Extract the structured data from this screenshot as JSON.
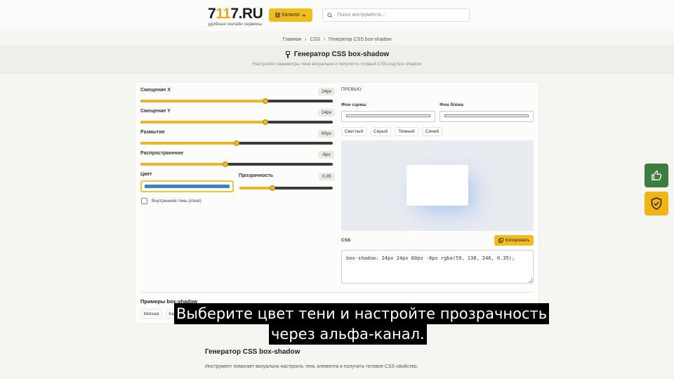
{
  "header": {
    "logo_prefix": "7",
    "logo_mid1": "1",
    "logo_mid2": "1",
    "logo_suffix": "7.RU",
    "logo_sub": "удобные онлайн сервисы",
    "catalog_label": "Каталог",
    "search_placeholder": "Поиск инструмента..."
  },
  "breadcrumb": [
    "Главная",
    "CSS",
    "Генератор CSS box-shadow"
  ],
  "page": {
    "title": "Генератор CSS box-shadow",
    "subtitle": "Настройте параметры тени визуально и получите готовый CSS-код box-shadow"
  },
  "controls": {
    "offset_x": {
      "label": "Смещение X",
      "value": "24px",
      "level": 0.65
    },
    "offset_y": {
      "label": "Смещение Y",
      "value": "24px",
      "level": 0.65
    },
    "blur": {
      "label": "Размытие",
      "value": "60px",
      "level": 0.5
    },
    "spread": {
      "label": "Распространение",
      "value": "-8px",
      "level": 0.44
    },
    "color_label": "Цвет",
    "color_value": "#3b82c4",
    "opacity": {
      "label": "Прозрачность",
      "value": "0.35",
      "level": 0.35
    },
    "inset_label": "Внутренняя тень (inset)",
    "inset_checked": false
  },
  "preview": {
    "label": "ПРЕВЬЮ",
    "scene_bg_label": "Фон сцены",
    "block_bg_label": "Фон блока",
    "bg_chips": [
      "Светлый",
      "Серый",
      "Темный",
      "Синий"
    ]
  },
  "css": {
    "label": "CSS",
    "copy_label": "Копировать",
    "code": "box-shadow: 24px 24px 60px -8px rgba(59, 130, 246, 0.35);"
  },
  "examples": {
    "title": "Примеры box-shadow",
    "chips": [
      "Мягкая",
      "Ка"
    ]
  },
  "subtitles": {
    "line1": "Выберите цвет тени и настройте прозрачность",
    "line2": "через альфа-канал."
  },
  "bottom": {
    "title": "Генератор CSS box-shadow",
    "text": "Инструмент помогает визуально настроить тень элемента и получить готовое CSS-свойство."
  },
  "side_buttons": [
    "thumbs-up-icon",
    "shield-check-icon"
  ],
  "colors": {
    "accent": "#f2bc1c",
    "slider_fill": "#e8b82a",
    "like_button": "#3d7d3f",
    "shield_button": "#f2b415"
  }
}
